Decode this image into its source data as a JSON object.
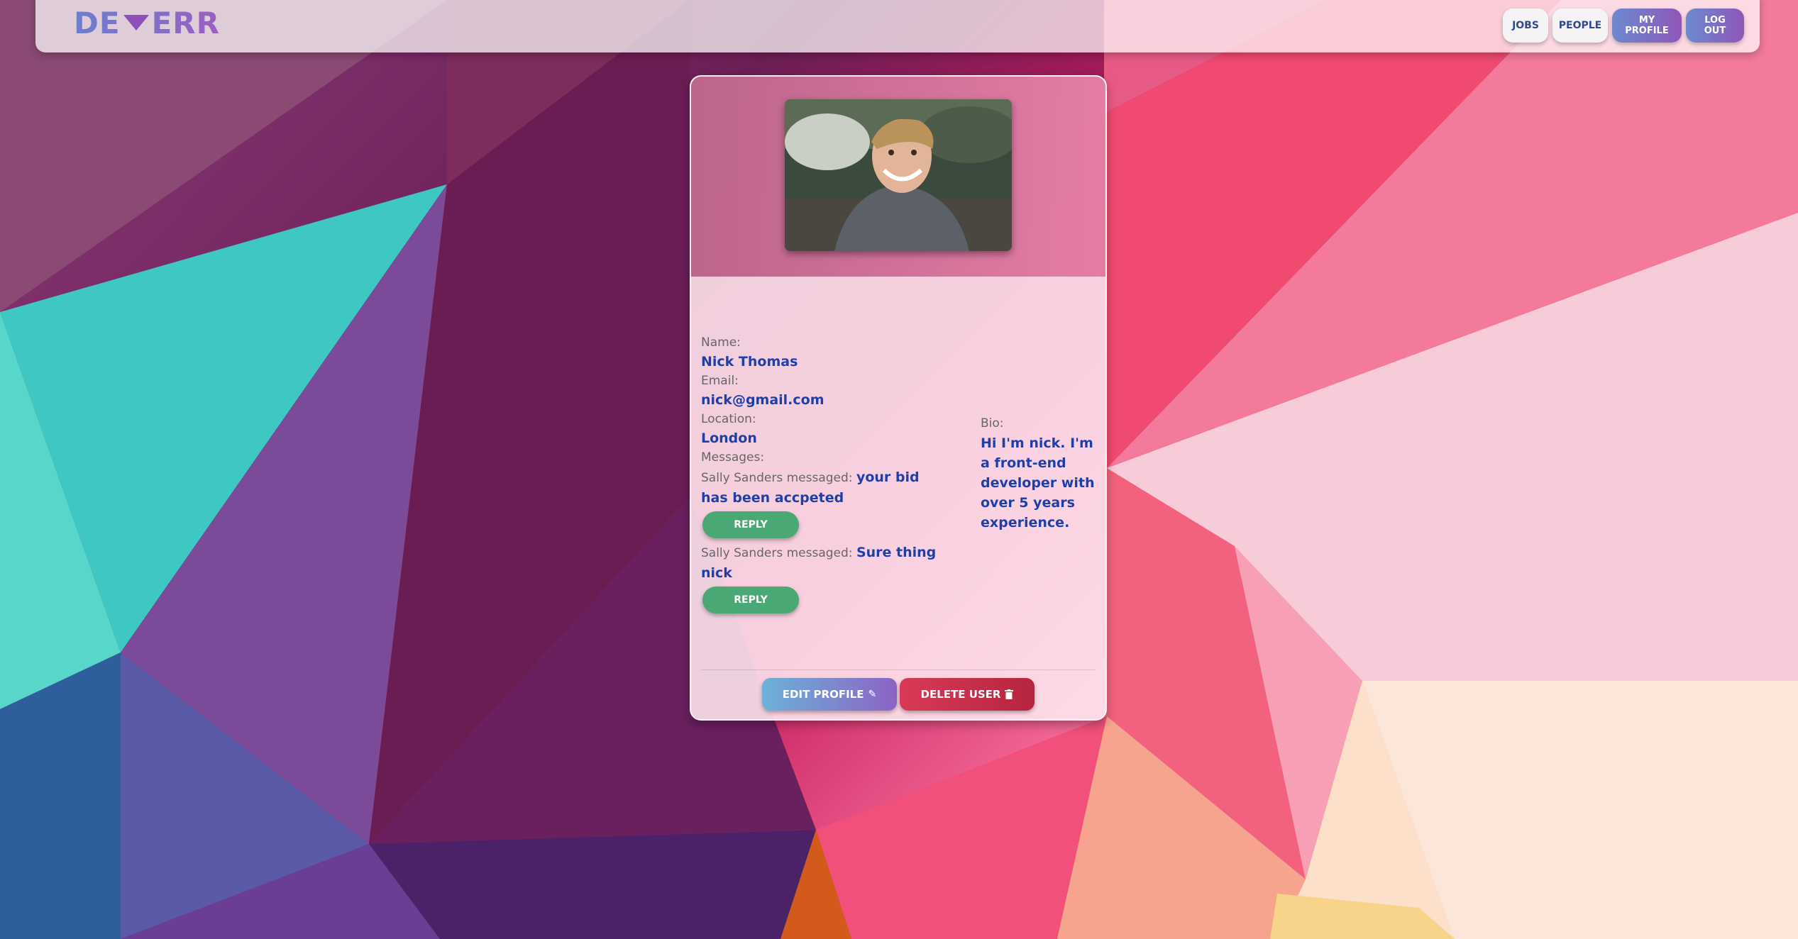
{
  "header": {
    "logo_left": "DE",
    "logo_right": "ERR",
    "nav": {
      "jobs": "JOBS",
      "people": "PEOPLE",
      "my_profile": "MY PROFILE",
      "log_out": "LOG OUT"
    }
  },
  "profile": {
    "name_label": "Name:",
    "name": "Nick Thomas",
    "email_label": "Email:",
    "email": "nick@gmail.com",
    "location_label": "Location:",
    "location": "London",
    "messages_label": "Messages:",
    "messages": [
      {
        "sender": "Sally Sanders messaged:",
        "text": "your bid has been accpeted",
        "reply_label": "REPLY"
      },
      {
        "sender": "Sally Sanders messaged:",
        "text": "Sure thing nick",
        "reply_label": "REPLY"
      }
    ],
    "bio_label": "Bio:",
    "bio": "Hi I'm nick. I'm a front-end developer with over 5 years experience."
  },
  "actions": {
    "edit_label": "EDIT PROFILE",
    "delete_label": "DELETE USER"
  },
  "icons": {
    "edit": "pencil-icon",
    "delete": "trash-icon",
    "logo": "triangle-down-icon"
  },
  "colors": {
    "value_text": "#1f3fa8",
    "reply_button": "#4aa874",
    "delete_button": "#c82c48",
    "nav_gradient_start": "#6b8ad0",
    "nav_gradient_end": "#8f56b8"
  }
}
